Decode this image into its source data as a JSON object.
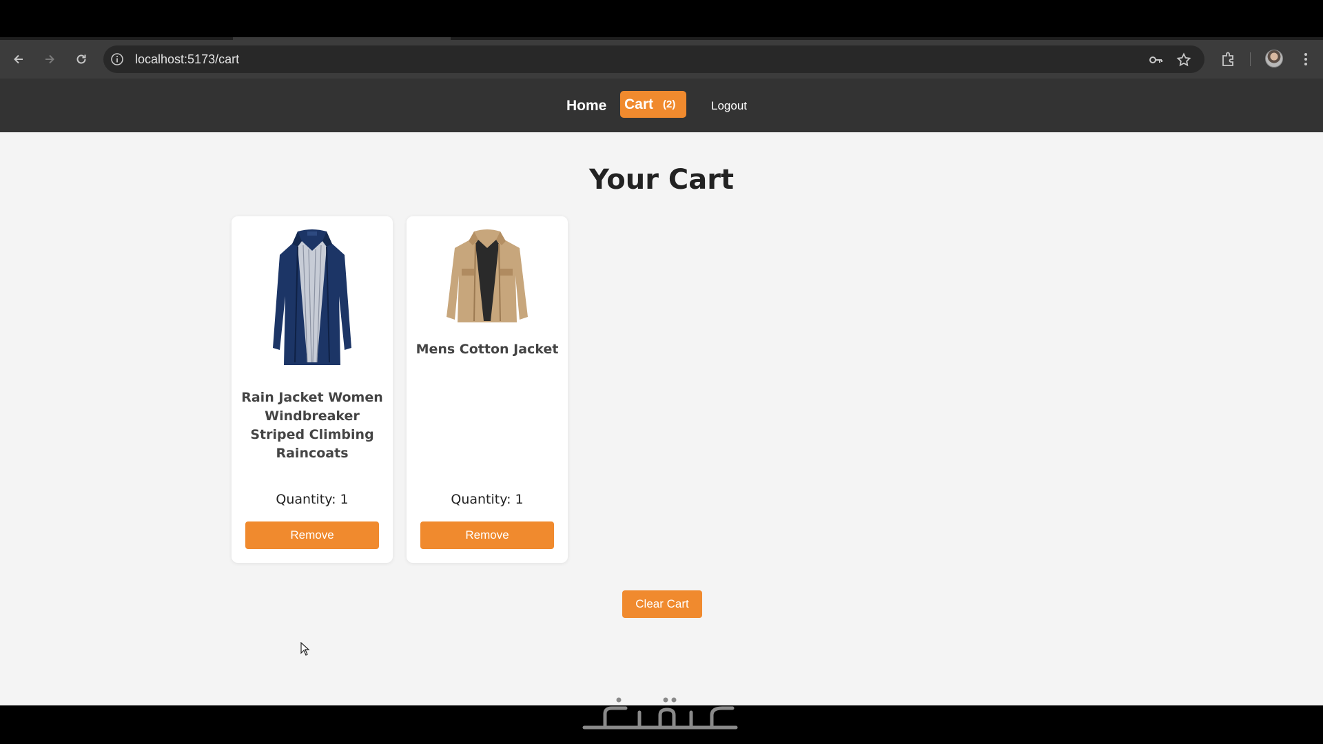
{
  "browser": {
    "url": "localhost:5173/cart",
    "back_icon": "back-arrow-icon",
    "forward_icon": "forward-arrow-icon",
    "reload_icon": "reload-icon",
    "info_icon": "info-icon",
    "password_icon": "key-icon",
    "bookmark_icon": "star-icon",
    "extensions_icon": "puzzle-icon",
    "menu_icon": "kebab-menu-icon"
  },
  "nav": {
    "home": "Home",
    "cart": "Cart",
    "cart_count": "(2)",
    "logout": "Logout"
  },
  "page": {
    "title": "Your Cart",
    "clear_label": "Clear Cart"
  },
  "cart_items": [
    {
      "name": "Rain Jacket Women Windbreaker Striped Climbing Raincoats",
      "quantity": "Quantity: 1",
      "remove_label": "Remove"
    },
    {
      "name": "Mens Cotton Jacket",
      "quantity": "Quantity: 1",
      "remove_label": "Remove"
    }
  ],
  "colors": {
    "accent": "#f08a2e",
    "nav_bg": "#333333",
    "page_bg": "#f4f4f4"
  }
}
